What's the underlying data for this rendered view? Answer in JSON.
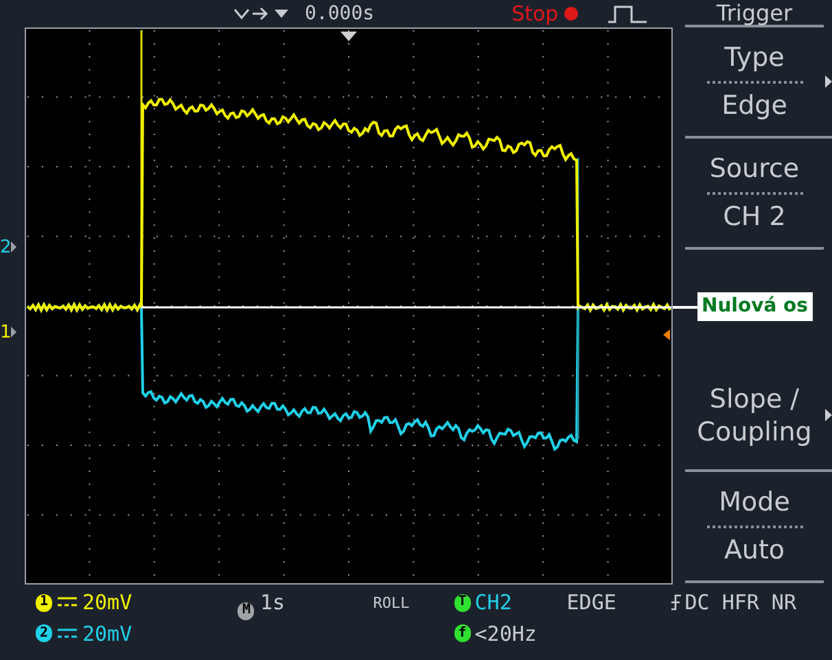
{
  "top_bar": {
    "position": "0.000s",
    "run_state": {
      "label": "Stop",
      "stopped": true
    }
  },
  "menu": {
    "title": "Trigger",
    "items": [
      {
        "kind": "pair",
        "label": "Type",
        "value": "Edge",
        "has_submenu": true
      },
      {
        "kind": "pair",
        "label": "Source",
        "value": "CH 2",
        "has_submenu": false
      },
      {
        "kind": "empty"
      },
      {
        "kind": "single",
        "label": "Slope / Coupling",
        "has_submenu": true
      },
      {
        "kind": "pair",
        "label": "Mode",
        "value": "Auto",
        "has_submenu": false
      }
    ]
  },
  "annotation": "Nulová os",
  "channel_markers": [
    {
      "label": "2",
      "color": "#20d0e8"
    },
    {
      "label": "1",
      "color": "#f0f000"
    }
  ],
  "status": {
    "channels": [
      {
        "badge": "1",
        "scale": "20mV",
        "color": "#f0f000"
      },
      {
        "badge": "2",
        "scale": "20mV",
        "color": "#20d0e8"
      }
    ],
    "timebase": {
      "badge": "M",
      "value": "1s"
    },
    "mode": "ROLL",
    "trigger": {
      "badge": "T",
      "source": "CH2",
      "type": "EDGE",
      "coupling": "DC",
      "filters": [
        "HFR",
        "NR"
      ]
    },
    "frequency": {
      "badge": "f",
      "value": "<20Hz"
    }
  }
}
